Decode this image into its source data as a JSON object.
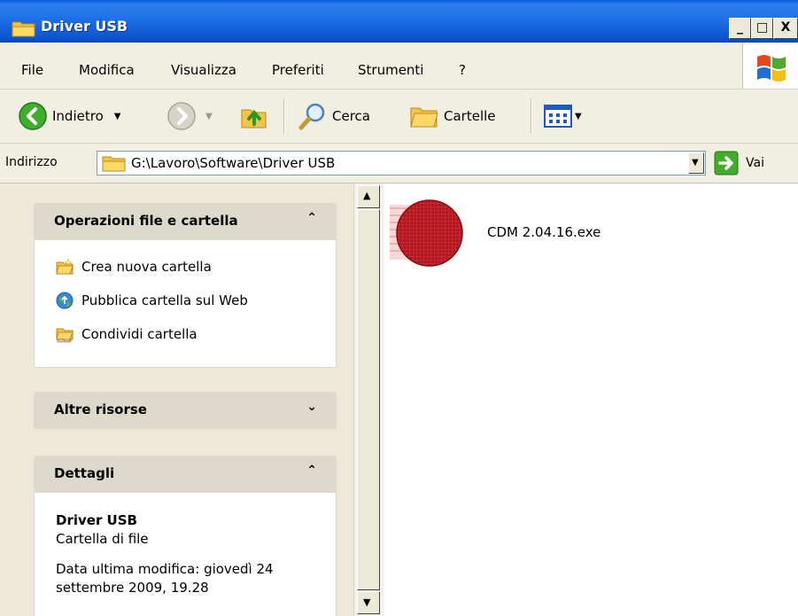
{
  "window": {
    "title": "Driver USB",
    "btn_minimize": "_",
    "btn_maximize": "□",
    "btn_close": "X"
  },
  "menu": {
    "items": [
      "File",
      "Modifica",
      "Visualizza",
      "Preferiti",
      "Strumenti",
      "?"
    ]
  },
  "toolbar": {
    "back_label": "Indietro",
    "search_label": "Cerca",
    "folders_label": "Cartelle"
  },
  "address": {
    "label": "Indirizzo",
    "path": "G:\\Lavoro\\Software\\Driver USB",
    "go_label": "Vai"
  },
  "taskpane": {
    "file_tasks": {
      "title": "Operazioni file e cartella",
      "items": [
        "Crea nuova cartella",
        "Pubblica cartella sul Web",
        "Condividi cartella"
      ]
    },
    "other_places": {
      "title": "Altre risorse"
    },
    "details": {
      "title": "Dettagli",
      "name": "Driver USB",
      "type": "Cartella di file",
      "modified_line1": "Data ultima modifica: giovedì 24",
      "modified_line2": "settembre 2009, 19.28"
    }
  },
  "files": [
    {
      "name": "CDM 2.04.16.exe",
      "icon": "installer-icon"
    }
  ],
  "colors": {
    "titlebar_blue": "#0d55cf",
    "panel_header": "#dedacb",
    "icon_red": "#b3161e"
  }
}
